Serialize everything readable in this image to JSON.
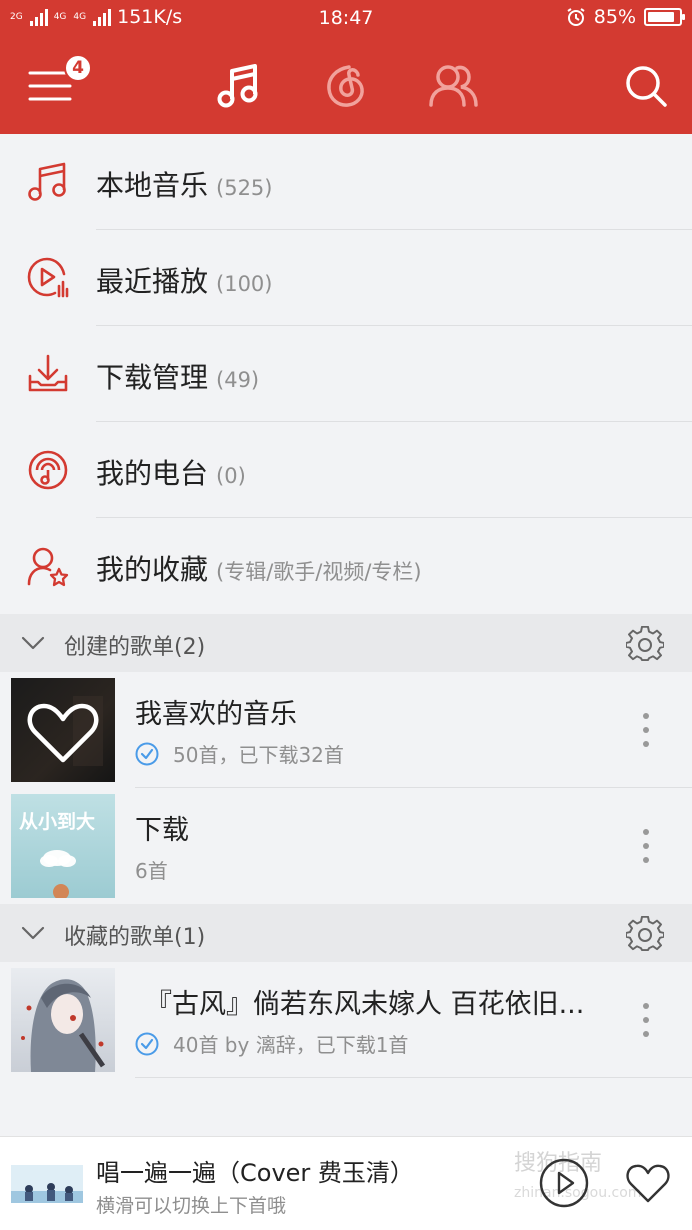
{
  "status_bar": {
    "network_small": "2G",
    "network_4g": "4G",
    "network_4g2": "4G",
    "speed": "151K/s",
    "time": "18:47",
    "battery": "85%",
    "battery_level": 0.85
  },
  "header": {
    "badge_count": "4",
    "active_tab": "music",
    "icons": [
      "menu-icon",
      "music-note-icon",
      "netease-cloud-icon",
      "friends-icon",
      "search-icon"
    ]
  },
  "menu": [
    {
      "label": "本地音乐",
      "count": "(525)",
      "icon": "music-note-icon"
    },
    {
      "label": "最近播放",
      "count": "(100)",
      "icon": "recent-play-icon"
    },
    {
      "label": "下载管理",
      "count": "(49)",
      "icon": "download-icon"
    },
    {
      "label": "我的电台",
      "count": "(0)",
      "icon": "radio-icon"
    },
    {
      "label": "我的收藏",
      "count": "(专辑/歌手/视频/专栏)",
      "icon": "collection-icon"
    }
  ],
  "created_section": {
    "title": "创建的歌单(2)",
    "playlists": [
      {
        "name": "我喜欢的音乐",
        "subtitle": "50首，已下载32首",
        "downloaded": true,
        "cover_text": ""
      },
      {
        "name": "下载",
        "subtitle": "6首",
        "downloaded": false,
        "cover_text": "从小到大"
      }
    ]
  },
  "collected_section": {
    "title": "收藏的歌单(1)",
    "playlists": [
      {
        "name": "『古风』倘若东风未嫁人 百花依旧...",
        "subtitle": "40首 by 漓辞，已下载1首",
        "downloaded": true
      }
    ]
  },
  "player": {
    "title": "唱一遍一遍（Cover 费玉清）",
    "hint": "横滑可以切换上下首哦"
  },
  "watermark": {
    "text": "搜狗指南",
    "sub": "zhinan.sogou.com"
  },
  "colors": {
    "brand_red": "#d33a31",
    "accent_blue": "#4a9be8"
  }
}
